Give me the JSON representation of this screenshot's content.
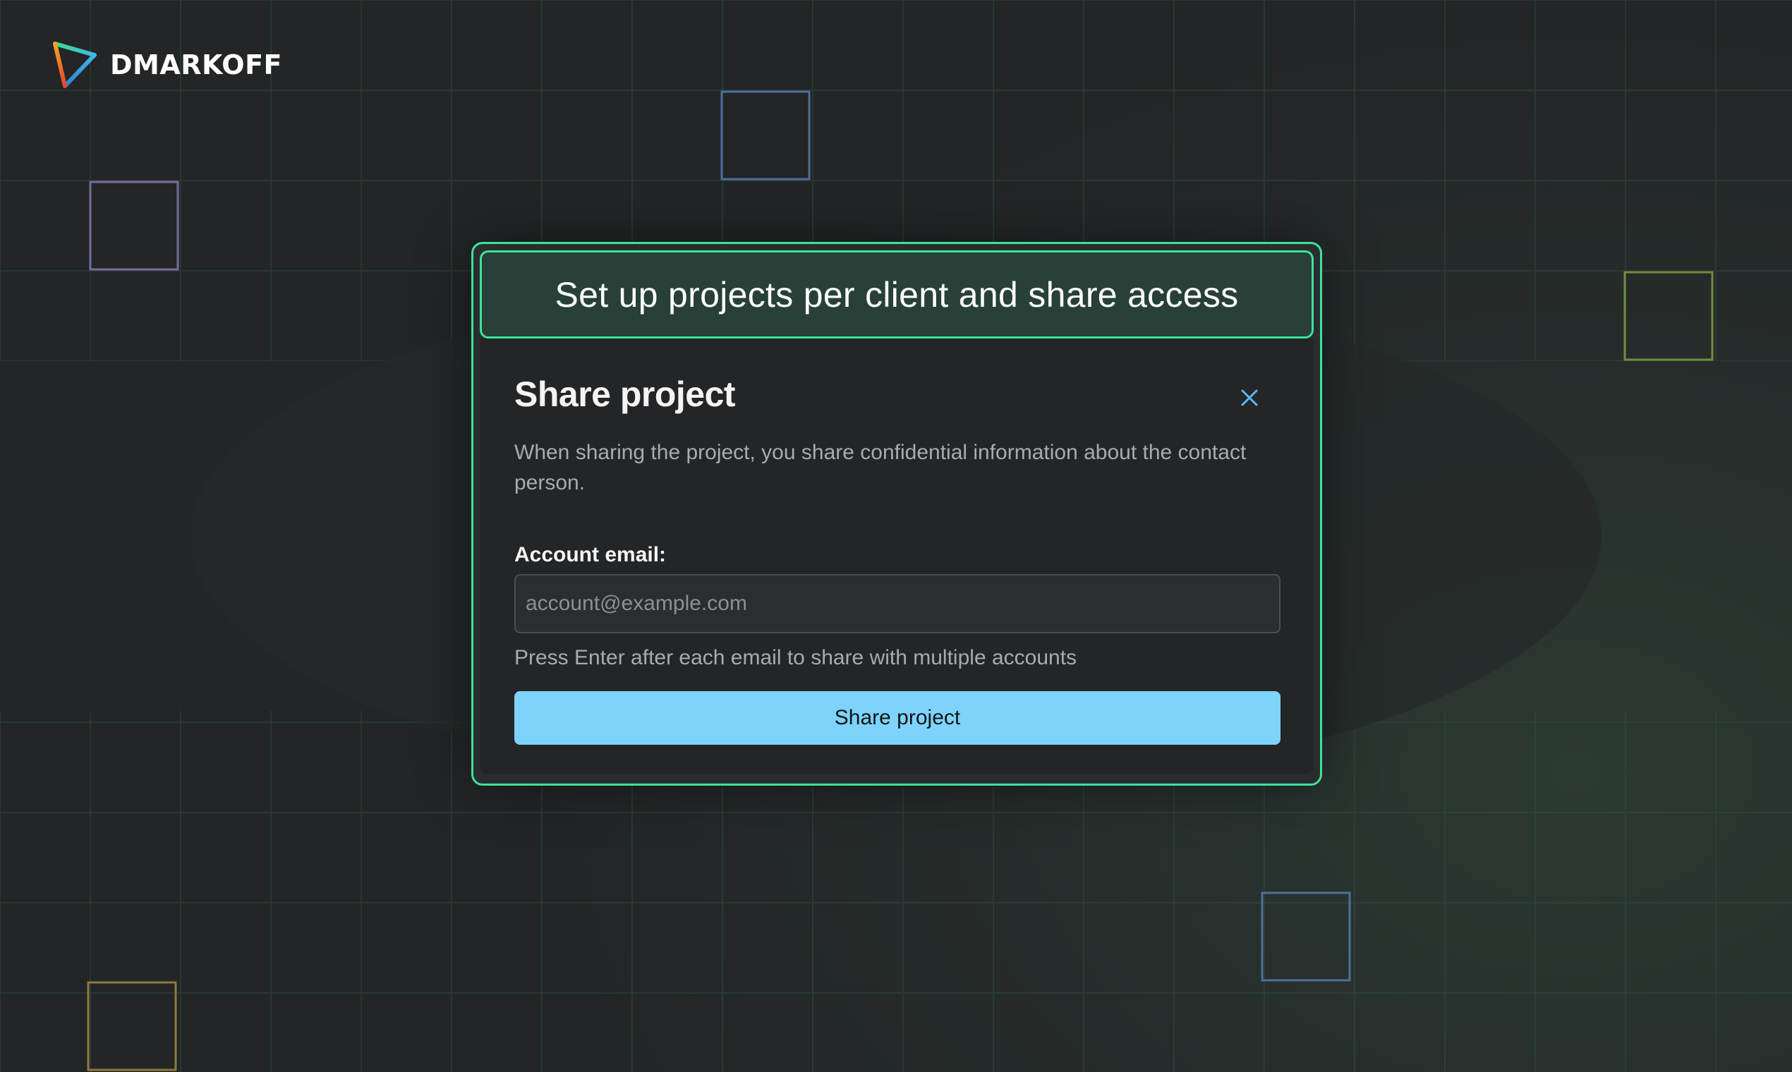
{
  "brand": {
    "name": "DMARKOFF",
    "logo_icon": "triangle-play-logo-icon"
  },
  "banner": {
    "text": "Set up projects per client and share access"
  },
  "dialog": {
    "title": "Share project",
    "description": "When sharing the project, you share confidential information about the contact person.",
    "close_icon": "close-icon",
    "email_label": "Account email:",
    "email_value": "",
    "email_placeholder": "account@example.com",
    "hint": "Press Enter after each email to share with multiple accounts",
    "submit_label": "Share project"
  },
  "colors": {
    "accent_border": "#3be39b",
    "banner_bg": "#284038",
    "dialog_bg": "#242527",
    "button_bg": "#7dd3fc",
    "close_icon": "#5ab8f0"
  }
}
